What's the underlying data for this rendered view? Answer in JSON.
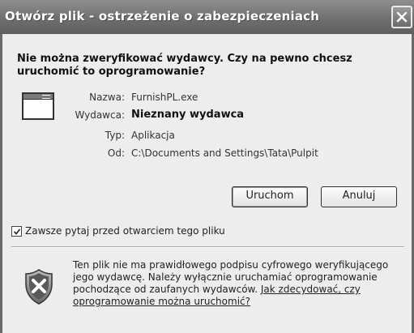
{
  "window": {
    "title": "Otwórz plik - ostrzeżenie o zabezpieczeniach"
  },
  "dialog": {
    "question": "Nie można zweryfikować wydawcy. Czy na pewno chcesz uruchomić to oprogramowanie?",
    "details": {
      "name_label": "Nazwa:",
      "name_value": "FurnishPL.exe",
      "publisher_label": "Wydawca:",
      "publisher_value": "Nieznany wydawca",
      "type_label": "Typ:",
      "type_value": "Aplikacja",
      "from_label": "Od:",
      "from_value": "C:\\Documents and Settings\\Tata\\Pulpit"
    },
    "buttons": {
      "run": "Uruchom",
      "cancel": "Anuluj"
    },
    "checkbox": {
      "label": "Zawsze pytaj przed otwarciem tego pliku",
      "checked": true
    },
    "warning": {
      "text": "Ten plik nie ma prawidłowego podpisu cyfrowego weryfikującego jego wydawcę. Należy wyłącznie uruchamiać oprogramowanie pochodzące od zaufanych wydawców. ",
      "link": "Jak zdecydować, czy oprogramowanie można uruchomić?"
    }
  },
  "icons": {
    "close": "close-icon",
    "application": "application-window-icon",
    "warning_shield": "security-shield-icon",
    "checkmark": "checkmark-icon"
  }
}
